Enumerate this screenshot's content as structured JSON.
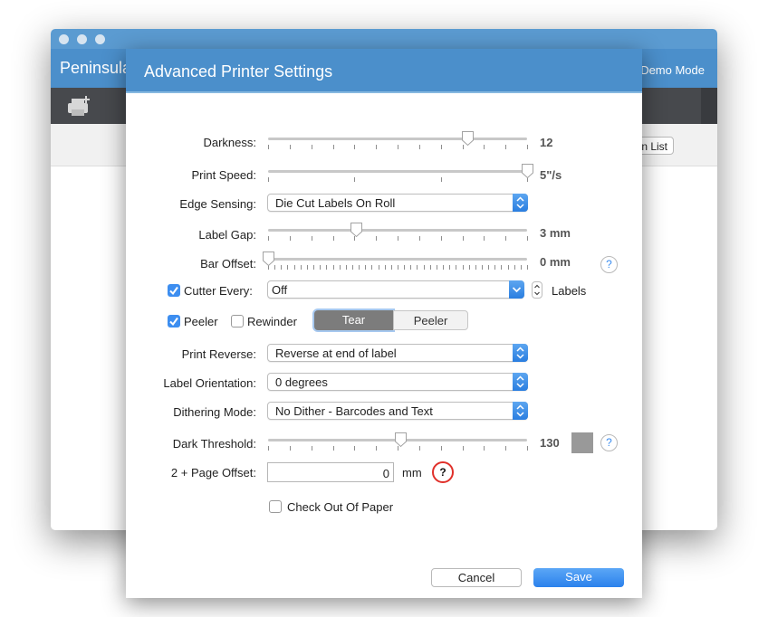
{
  "main_window": {
    "app_title": "Peninsula",
    "mode_label": "Demo Mode",
    "list_button_fragment": "n List"
  },
  "dialog": {
    "title": "Advanced Printer Settings",
    "darkness": {
      "label": "Darkness:",
      "value": "12",
      "level": 0.77
    },
    "print_speed": {
      "label": "Print Speed:",
      "value": "5\"/s",
      "level": 1.0
    },
    "edge_sensing": {
      "label": "Edge Sensing:",
      "selected": "Die Cut Labels On Roll"
    },
    "label_gap": {
      "label": "Label Gap:",
      "value": "3 mm",
      "level": 0.34
    },
    "bar_offset": {
      "label": "Bar Offset:",
      "value": "0 mm",
      "level": 0.0
    },
    "cutter_every": {
      "label": "Cutter Every:",
      "checked": true,
      "selected": "Off",
      "unit": "Labels"
    },
    "peeler": {
      "label": "Peeler",
      "checked": true
    },
    "rewinder": {
      "label": "Rewinder",
      "checked": false
    },
    "mode_segment": {
      "tear": "Tear",
      "peeler": "Peeler",
      "selected": "Tear"
    },
    "print_reverse": {
      "label": "Print Reverse:",
      "selected": "Reverse at end of label"
    },
    "label_orientation": {
      "label": "Label Orientation:",
      "selected": "0 degrees"
    },
    "dithering_mode": {
      "label": "Dithering Mode:",
      "selected": "No Dither - Barcodes and Text"
    },
    "dark_threshold": {
      "label": "Dark Threshold:",
      "value": "130",
      "level": 0.51,
      "swatch_color": "#999999"
    },
    "page_offset": {
      "label": "2 + Page Offset:",
      "value": "0",
      "unit": "mm"
    },
    "check_out_of_paper": {
      "label": "Check Out Of Paper",
      "checked": false
    },
    "help_glyph": "?",
    "cancel_label": "Cancel",
    "save_label": "Save"
  },
  "colors": {
    "accent": "#4b8fcb",
    "button_blue": "#2b81ec",
    "help_highlight": "#e0302a"
  }
}
